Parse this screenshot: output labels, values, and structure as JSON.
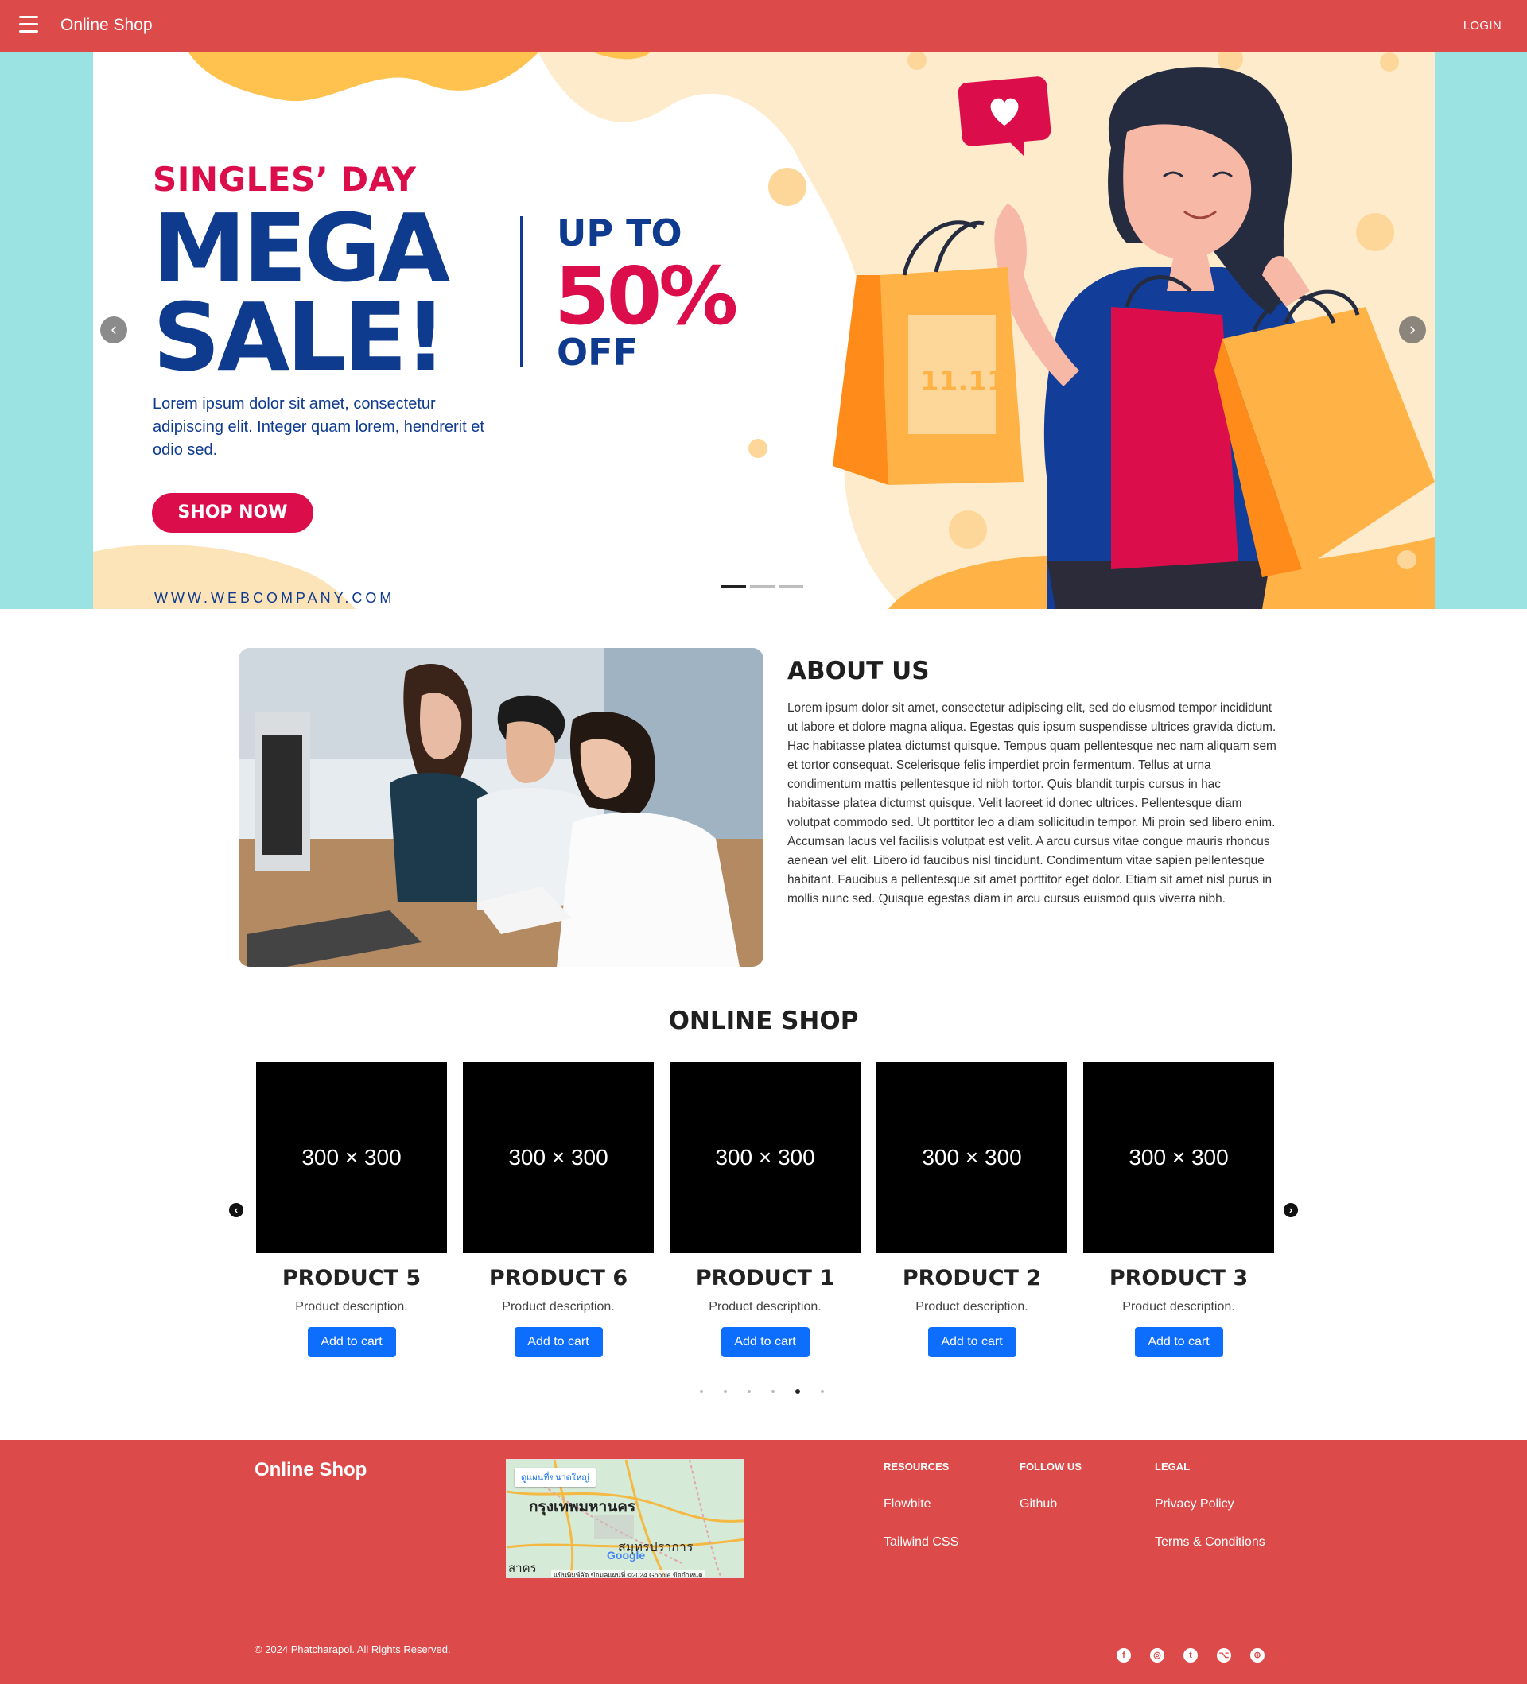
{
  "navbar": {
    "brand": "Online Shop",
    "login_label": "LOGIN",
    "menu_icon": "hamburger-menu-icon"
  },
  "hero": {
    "kicker": "SINGLES’ DAY",
    "headline_line1": "MEGA",
    "headline_line2": "SALE!",
    "up_to": "UP TO",
    "percent": "50%",
    "off": "OFF",
    "description": "Lorem ipsum dolor sit amet, consectetur adipiscing elit. Integer quam lorem, hendrerit et odio sed.",
    "cta_label": "SHOP NOW",
    "website": "WWW.WEBCOMPANY.COM",
    "bag_label": "11.11",
    "slide_count": 3,
    "active_slide": 1,
    "prev_icon": "chevron-left-icon",
    "next_icon": "chevron-right-icon",
    "colors": {
      "brand_red": "#dc0d4b",
      "brand_blue": "#0f3b8f",
      "accent_orange": "#ffb347",
      "bg_cyan": "#9be2e3"
    }
  },
  "about": {
    "title": "ABOUT US",
    "body": "Lorem ipsum dolor sit amet, consectetur adipiscing elit, sed do eiusmod tempor incididunt ut labore et dolore magna aliqua. Egestas quis ipsum suspendisse ultrices gravida dictum. Hac habitasse platea dictumst quisque. Tempus quam pellentesque nec nam aliquam sem et tortor consequat. Scelerisque felis imperdiet proin fermentum. Tellus at urna condimentum mattis pellentesque id nibh tortor. Quis blandit turpis cursus in hac habitasse platea dictumst quisque. Velit laoreet id donec ultrices. Pellentesque diam volutpat commodo sed. Ut porttitor leo a diam sollicitudin tempor. Mi proin sed libero enim. Accumsan lacus vel facilisis volutpat est velit. A arcu cursus vitae congue mauris rhoncus aenean vel elit. Libero id faucibus nisl tincidunt. Condimentum vitae sapien pellentesque habitant. Faucibus a pellentesque sit amet porttitor eget dolor. Etiam sit amet nisl purus in mollis nunc sed. Quisque egestas diam in arcu cursus euismod quis viverra nibh."
  },
  "shop": {
    "title": "ONLINE SHOP",
    "products": [
      {
        "placeholder": "300 × 300",
        "name": "PRODUCT 5",
        "description": "Product description.",
        "button": "Add to cart"
      },
      {
        "placeholder": "300 × 300",
        "name": "PRODUCT 6",
        "description": "Product description.",
        "button": "Add to cart"
      },
      {
        "placeholder": "300 × 300",
        "name": "PRODUCT 1",
        "description": "Product description.",
        "button": "Add to cart"
      },
      {
        "placeholder": "300 × 300",
        "name": "PRODUCT 2",
        "description": "Product description.",
        "button": "Add to cart"
      },
      {
        "placeholder": "300 × 300",
        "name": "PRODUCT 3",
        "description": "Product description.",
        "button": "Add to cart"
      }
    ],
    "page_count": 6,
    "active_page": 5,
    "prev_icon": "arrow-left-circle-icon",
    "next_icon": "arrow-right-circle-icon",
    "button_color": "#0d6efd"
  },
  "footer": {
    "brand": "Online Shop",
    "map": {
      "button": "ดูแผนที่ขนาดใหญ่",
      "city_main": "กรุงเทพมหานคร",
      "city_east": "สมุทรปราการ",
      "city_west": "สาคร",
      "logo": "Google",
      "attribution": "แป้นพิมพ์ลัด ข้อมูลแผนที่ ©2024 Google ข้อกำหนด"
    },
    "columns": [
      {
        "heading": "RESOURCES",
        "links": [
          "Flowbite",
          "Tailwind CSS"
        ]
      },
      {
        "heading": "FOLLOW US",
        "links": [
          "Github"
        ]
      },
      {
        "heading": "LEGAL",
        "links": [
          "Privacy Policy",
          "Terms & Conditions"
        ]
      }
    ],
    "copyright": "© 2024 Phatcharapol. All Rights Reserved.",
    "socials": [
      "facebook-icon",
      "instagram-icon",
      "twitter-icon",
      "github-icon",
      "dribbble-icon"
    ],
    "bg_color": "#dd4a4a"
  }
}
